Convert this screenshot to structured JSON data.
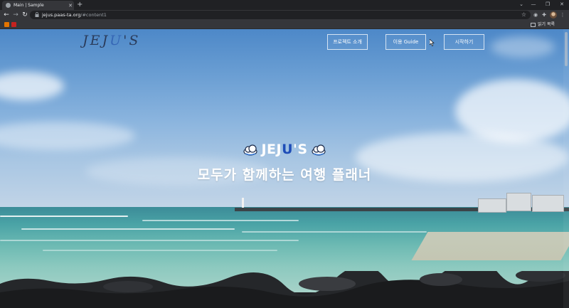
{
  "browser": {
    "tab_title": "Main | Sample",
    "url_host": "jejus.paas-ta.org",
    "url_path": "/#content1",
    "reading_list_label": "읽기 목록"
  },
  "page": {
    "logo_left": "JEJ",
    "logo_accent": "U",
    "logo_right": "'S",
    "nav": [
      {
        "label": "프로젝트 소개"
      },
      {
        "label": "이용 Guide"
      },
      {
        "label": "시작하기"
      }
    ],
    "hero_title_white": "JEJ",
    "hero_title_blue": "U",
    "hero_title_end": "'S",
    "hero_subtitle": "모두가 함께하는 여행 플래너"
  },
  "colors": {
    "logo_text": "#2a3b5a",
    "accent_blue": "#1e4db8",
    "chrome_dark": "#202124",
    "chrome_toolbar": "#35363a"
  }
}
